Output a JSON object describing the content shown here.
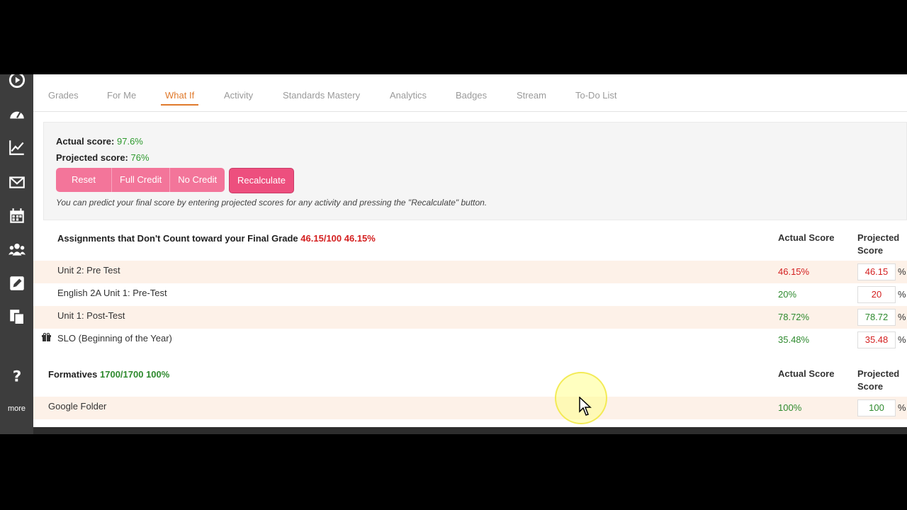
{
  "tabs": [
    "Grades",
    "For Me",
    "What If",
    "Activity",
    "Standards Mastery",
    "Analytics",
    "Badges",
    "Stream",
    "To-Do List"
  ],
  "active_tab": "What If",
  "whatif": {
    "actual_label": "Actual score:",
    "actual_value": "97.6%",
    "projected_label": "Projected score:",
    "projected_value": "76%",
    "buttons": [
      "Reset",
      "Full Credit",
      "No Credit"
    ],
    "recalculate": "Recalculate",
    "hint": "You can predict your final score by entering projected scores for any activity and pressing the \"Recalculate\" button."
  },
  "section1": {
    "title": "Assignments that Don't Count toward your Final Grade",
    "score": "46.15/100 46.15%",
    "col_actual": "Actual Score",
    "col_projected_1": "Projected",
    "col_projected_2": "Score",
    "rows": [
      {
        "name": "Unit 2: Pre Test",
        "actual": "46.15%",
        "projected": "46.15",
        "pct": "%"
      },
      {
        "name": "English 2A Unit 1: Pre-Test",
        "actual": "20%",
        "projected": "20",
        "pct": "%"
      },
      {
        "name": "Unit 1: Post-Test",
        "actual": "78.72%",
        "projected": "78.72",
        "pct": "%"
      },
      {
        "name": "SLO (Beginning of the Year)",
        "actual": "35.48%",
        "projected": "35.48",
        "pct": "%"
      }
    ]
  },
  "section2": {
    "title": "Formatives",
    "score": "1700/1700 100%",
    "col_actual": "Actual Score",
    "col_projected_1": "Projected",
    "col_projected_2": "Score",
    "rows": [
      {
        "name": "Google Folder",
        "actual": "100%",
        "projected": "100",
        "pct": "%"
      }
    ]
  },
  "sidebar": {
    "more": "more"
  },
  "colors": {
    "accent": "#e07a2c",
    "button": "#f3759a",
    "recalc": "#ed4f7e",
    "sidebar": "#3d3d3d"
  }
}
